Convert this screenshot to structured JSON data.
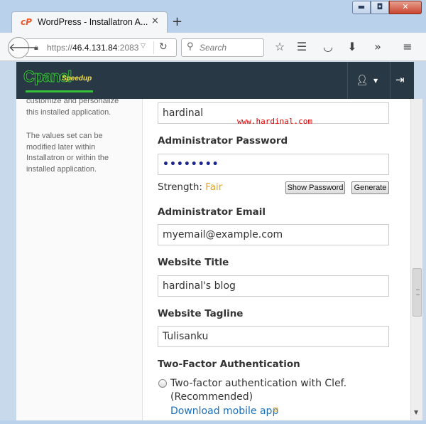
{
  "browser": {
    "tab_title": "WordPress - Installatron A...",
    "tab_close": "×",
    "new_tab": "+",
    "url_prefix": "https://",
    "url_host": "46.4.131.84",
    "url_port": ":2083,",
    "search_placeholder": "Search",
    "window_controls": {
      "minimize": "▬",
      "maximize": "◘",
      "close": "✕"
    }
  },
  "cpanel": {
    "logo_text": "Cpanel",
    "logo_sub": "Speedup"
  },
  "sidebar": {
    "help_1": "customize and personalize this installed application.",
    "help_2": "The values set can be modified later within Installatron or within the installed application."
  },
  "form": {
    "username_value": "hardinal",
    "watermark": "www.hardinal.com",
    "password_label": "Administrator Password",
    "password_value": "••••••••",
    "strength_label": "Strength:",
    "strength_value": "Fair",
    "strength_color": "#e8a317",
    "show_password_label": "Show Password",
    "generate_label": "Generate",
    "email_label": "Administrator Email",
    "email_value": "myemail@example.com",
    "title_label": "Website Title",
    "title_value": "hardinal's blog",
    "tagline_label": "Website Tagline",
    "tagline_value": "Tulisanku",
    "twofactor_label": "Two-Factor Authentication",
    "twofactor_option": "Two-factor authentication with Clef. (Recommended)",
    "download_link": "Download mobile app"
  },
  "colors": {
    "header_bg": "#283844",
    "link": "#1a6fb8",
    "watermark": "#dd0000"
  }
}
